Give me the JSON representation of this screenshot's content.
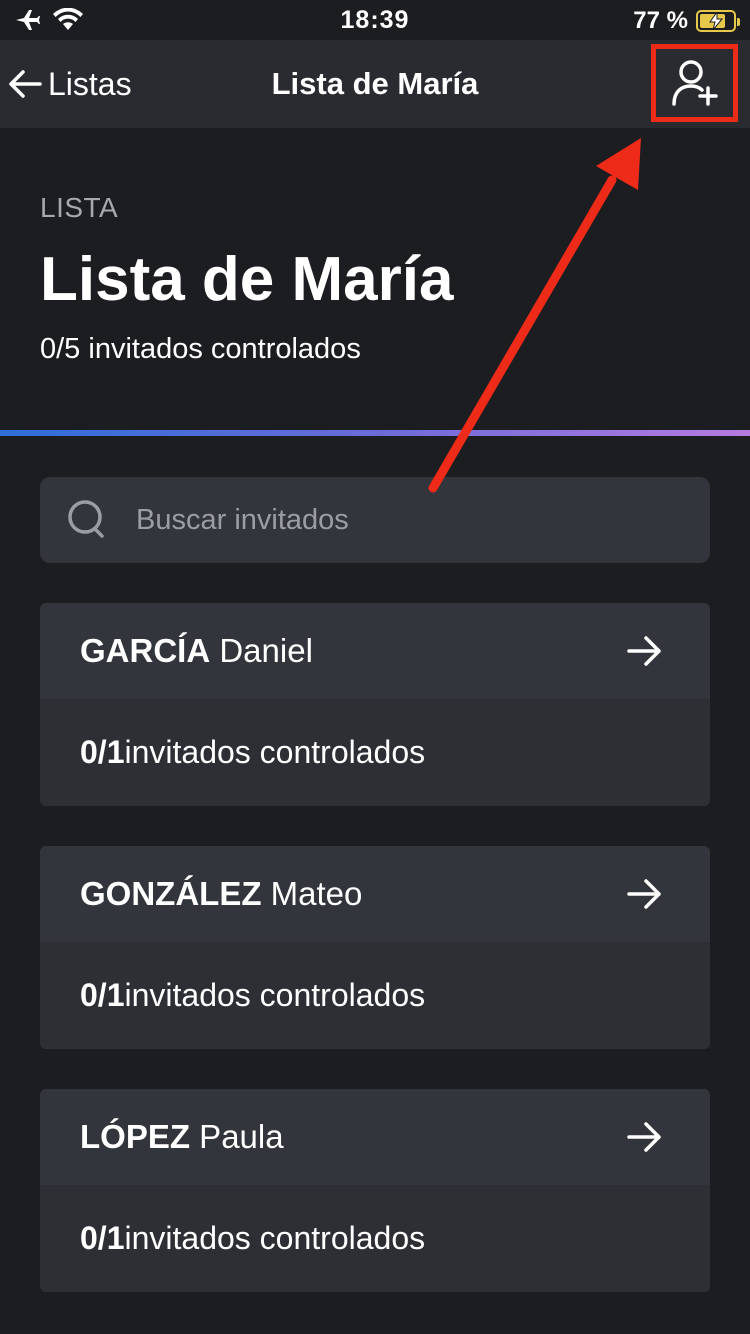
{
  "status_bar": {
    "time": "18:39",
    "battery": "77 %",
    "icons": [
      "airplane-icon",
      "wifi-icon",
      "battery-charging-icon"
    ]
  },
  "nav": {
    "back_label": "Listas",
    "title": "Lista de María",
    "action_icon": "add-user-icon"
  },
  "header": {
    "eyebrow": "LISTA",
    "title": "Lista de María",
    "subtitle": "0/5 invitados controlados"
  },
  "search": {
    "placeholder": "Buscar invitados",
    "value": ""
  },
  "guests": [
    {
      "surname": "GARCÍA",
      "first_name": " Daniel",
      "count": "0/1",
      "count_label": "invitados controlados"
    },
    {
      "surname": "GONZÁLEZ",
      "first_name": " Mateo",
      "count": "0/1",
      "count_label": "invitados controlados"
    },
    {
      "surname": "LÓPEZ",
      "first_name": " Paula",
      "count": "0/1",
      "count_label": "invitados controlados"
    }
  ],
  "colors": {
    "background": "#1c1d21",
    "nav_background": "#2a2b31",
    "card_header": "#33353c",
    "card_body": "#2d2f35",
    "highlight": "#ee2a18",
    "gradient_start": "#2e6fd9",
    "gradient_end": "#b57be0"
  }
}
